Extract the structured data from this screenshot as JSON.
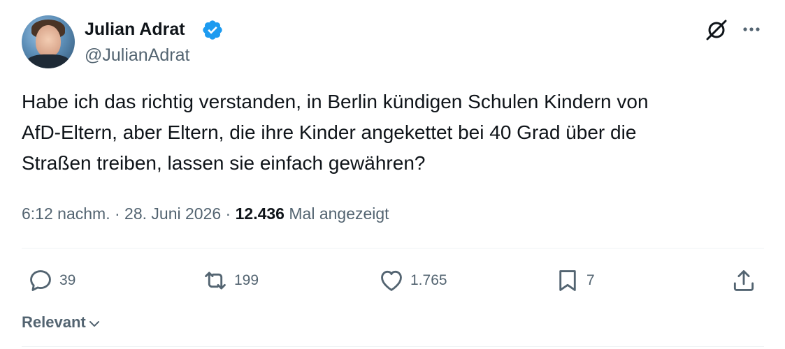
{
  "author": {
    "display_name": "Julian Adrat",
    "handle": "@JulianAdrat",
    "verified": true,
    "verified_color": "#1d9bf0"
  },
  "tweet": {
    "lines": [
      "Habe ich das richtig verstanden, in Berlin kündigen Schulen Kindern von",
      "AfD-Eltern, aber Eltern, die ihre Kinder angekettet bei 40 Grad über die",
      "Straßen treiben, lassen sie einfach gewähren?"
    ]
  },
  "meta": {
    "time": "6:12 nachm.",
    "separator1": " · ",
    "date": "28. Juni 2026",
    "separator2": " · ",
    "views_count": "12.436",
    "views_label": " Mal angezeigt"
  },
  "actions": {
    "reply": {
      "icon": "reply-icon",
      "count": "39"
    },
    "repost": {
      "icon": "repost-icon",
      "count": "199"
    },
    "like": {
      "icon": "heart-icon",
      "count": "1.765"
    },
    "bookmark": {
      "icon": "bookmark-icon",
      "count": "7"
    },
    "share": {
      "icon": "share-icon"
    }
  },
  "replies_sort": {
    "label": "Relevant"
  },
  "colors": {
    "text": "#0f1419",
    "secondary": "#536471",
    "divider": "#eff3f4"
  }
}
